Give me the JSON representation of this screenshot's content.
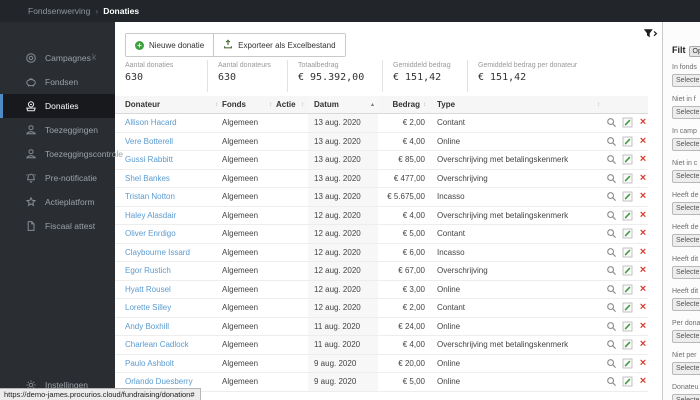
{
  "topbar": {
    "breadcrumb_root": "Fondsenwerving",
    "breadcrumb_sep": "›",
    "breadcrumb_current": "Donaties"
  },
  "sidebar": {
    "overflow_text": "k",
    "items": [
      {
        "label": "Campagnes",
        "icon": "target-icon",
        "active": false
      },
      {
        "label": "Fondsen",
        "icon": "piggy-bank-icon",
        "active": false
      },
      {
        "label": "Donaties",
        "icon": "euro-donation-icon",
        "active": true
      },
      {
        "label": "Toezeggingen",
        "icon": "hand-coin-icon",
        "active": false
      },
      {
        "label": "Toezeggingscontrole",
        "icon": "hand-coin-icon",
        "active": false
      },
      {
        "label": "Pre-notificatie",
        "icon": "bell-icon",
        "active": false
      },
      {
        "label": "Actieplatform",
        "icon": "star-icon",
        "active": false
      },
      {
        "label": "Fiscaal attest",
        "icon": "document-icon",
        "active": false
      }
    ],
    "bottom_item": {
      "label": "Instellingen",
      "icon": "gear-icon"
    }
  },
  "toolbar": {
    "new_donation": "Nieuwe donatie",
    "export": "Exporteer als Excelbestand"
  },
  "stats": [
    {
      "label": "Aantal donaties",
      "value": "630"
    },
    {
      "label": "Aantal donateurs",
      "value": "630"
    },
    {
      "label": "Totaalbedrag",
      "value": "€ 95.392,00"
    },
    {
      "label": "Gemiddeld bedrag",
      "value": "€ 151,42"
    },
    {
      "label": "Gemiddeld bedrag per donateur",
      "value": "€ 151,42"
    }
  ],
  "table": {
    "columns": [
      "Donateur",
      "Fonds",
      "Actie",
      "Datum",
      "Bedrag",
      "Type"
    ],
    "sorted": {
      "column": "Datum",
      "direction": "asc"
    },
    "rows": [
      {
        "donor": "Allison Hacard",
        "fund": "Algemeen",
        "action": "",
        "date": "13 aug. 2020",
        "amount": "€ 2,00",
        "type": "Contant"
      },
      {
        "donor": "Vere Botterell",
        "fund": "Algemeen",
        "action": "",
        "date": "13 aug. 2020",
        "amount": "€ 4,00",
        "type": "Online"
      },
      {
        "donor": "Gussi Rabbitt",
        "fund": "Algemeen",
        "action": "",
        "date": "13 aug. 2020",
        "amount": "€ 85,00",
        "type": "Overschrijving met betalingskenmerk"
      },
      {
        "donor": "Shel Bankes",
        "fund": "Algemeen",
        "action": "",
        "date": "13 aug. 2020",
        "amount": "€ 477,00",
        "type": "Overschrijving"
      },
      {
        "donor": "Tristan Notton",
        "fund": "Algemeen",
        "action": "",
        "date": "13 aug. 2020",
        "amount": "€ 5.675,00",
        "type": "Incasso"
      },
      {
        "donor": "Haley Alasdair",
        "fund": "Algemeen",
        "action": "",
        "date": "12 aug. 2020",
        "amount": "€ 4,00",
        "type": "Overschrijving met betalingskenmerk"
      },
      {
        "donor": "Oliver Enrdigo",
        "fund": "Algemeen",
        "action": "",
        "date": "12 aug. 2020",
        "amount": "€ 5,00",
        "type": "Contant"
      },
      {
        "donor": "Claybourne Issard",
        "fund": "Algemeen",
        "action": "",
        "date": "12 aug. 2020",
        "amount": "€ 6,00",
        "type": "Incasso"
      },
      {
        "donor": "Egor Rustich",
        "fund": "Algemeen",
        "action": "",
        "date": "12 aug. 2020",
        "amount": "€ 67,00",
        "type": "Overschrijving"
      },
      {
        "donor": "Hyatt Rousel",
        "fund": "Algemeen",
        "action": "",
        "date": "12 aug. 2020",
        "amount": "€ 3,00",
        "type": "Online"
      },
      {
        "donor": "Lorette Silley",
        "fund": "Algemeen",
        "action": "",
        "date": "12 aug. 2020",
        "amount": "€ 2,00",
        "type": "Contant"
      },
      {
        "donor": "Andy Boxhill",
        "fund": "Algemeen",
        "action": "",
        "date": "11 aug. 2020",
        "amount": "€ 24,00",
        "type": "Online"
      },
      {
        "donor": "Charlean Cadlock",
        "fund": "Algemeen",
        "action": "",
        "date": "11 aug. 2020",
        "amount": "€ 4,00",
        "type": "Overschrijving met betalingskenmerk"
      },
      {
        "donor": "Paulo Ashbolt",
        "fund": "Algemeen",
        "action": "",
        "date": "9 aug. 2020",
        "amount": "€ 20,00",
        "type": "Online"
      },
      {
        "donor": "Orlando Duesberry",
        "fund": "Algemeen",
        "action": "",
        "date": "9 aug. 2020",
        "amount": "€ 5,00",
        "type": "Online"
      }
    ],
    "row_action_icons": [
      "view-icon",
      "edit-icon",
      "delete-icon"
    ]
  },
  "filter_panel": {
    "title": "Filt",
    "saved_button": "Ope",
    "select_placeholder": "Selecte",
    "fields": [
      "In fonds",
      "Niet in f",
      "In camp",
      "Niet in c",
      "Heeft de",
      "Heeft de",
      "Heeft dit",
      "Heeft dit",
      "Per dona",
      "Niet per",
      "Donateu"
    ]
  },
  "browser": {
    "status_url": "https://demo-james.procurios.cloud/fundraising/donation#"
  },
  "colors": {
    "accent_blue": "#4e8cc8",
    "link_blue": "#5b9bd0",
    "delete_red": "#d43f2f",
    "add_green": "#3fa13f",
    "topbar_bg": "#22262a",
    "sidebar_bg": "#2a2e32"
  }
}
